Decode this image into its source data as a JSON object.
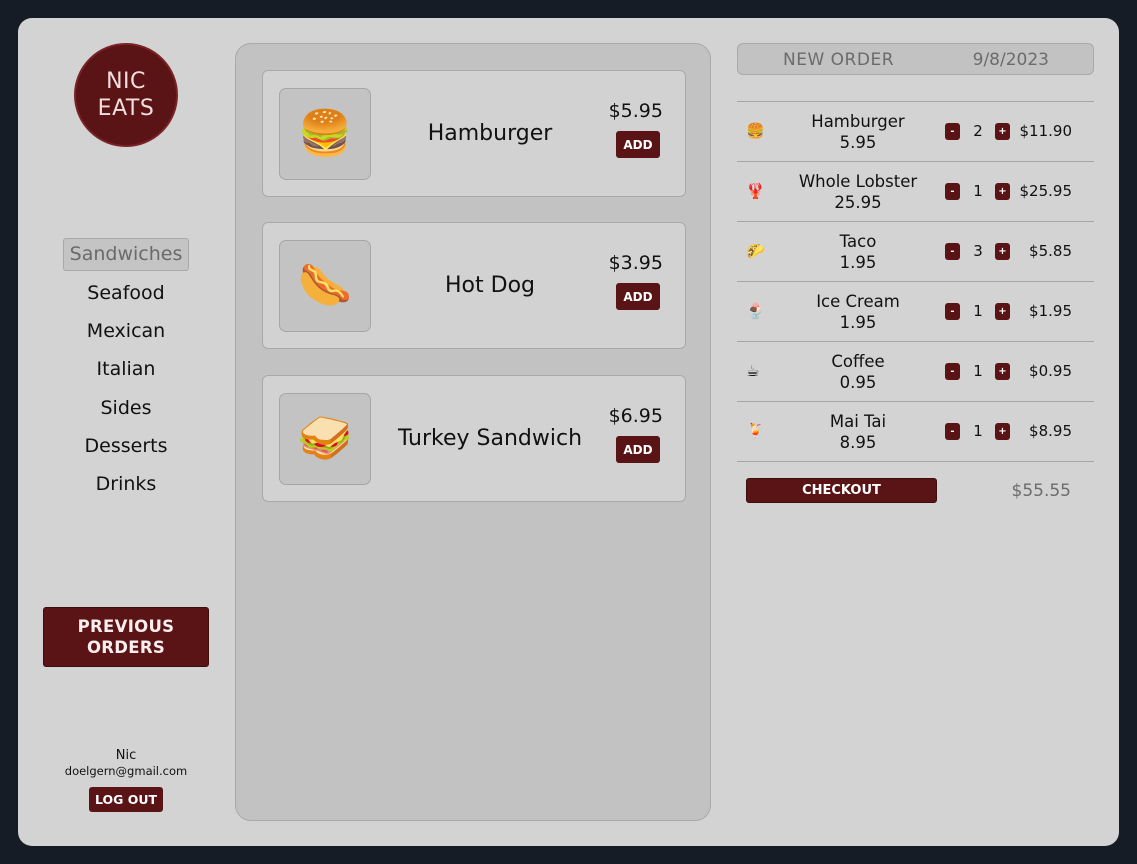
{
  "brand": {
    "line1": "NIC",
    "line2": "EATS"
  },
  "colors": {
    "accent": "#5a1416",
    "panel": "#d3d3d3",
    "background": "#161c26"
  },
  "categories": [
    {
      "label": "Sandwiches",
      "active": true
    },
    {
      "label": "Seafood"
    },
    {
      "label": "Mexican"
    },
    {
      "label": "Italian"
    },
    {
      "label": "Sides"
    },
    {
      "label": "Desserts"
    },
    {
      "label": "Drinks"
    }
  ],
  "previous_orders": {
    "line1": "PREVIOUS",
    "line2": "ORDERS"
  },
  "user": {
    "name": "Nic",
    "email": "doelgern@gmail.com",
    "logout": "LOG OUT"
  },
  "menu": {
    "items": [
      {
        "name": "Hamburger",
        "price": "$5.95",
        "emoji": "🍔",
        "icon": "hamburger-icon",
        "add": "ADD"
      },
      {
        "name": "Hot Dog",
        "price": "$3.95",
        "emoji": "🌭",
        "icon": "hot-dog-icon",
        "add": "ADD"
      },
      {
        "name": "Turkey Sandwich",
        "price": "$6.95",
        "emoji": "🥪",
        "icon": "sandwich-icon",
        "add": "ADD"
      }
    ]
  },
  "order": {
    "title": "NEW ORDER",
    "date": "9/8/2023",
    "items": [
      {
        "emoji": "🍔",
        "icon": "hamburger-icon",
        "name": "Hamburger",
        "price": "5.95",
        "qty": "2",
        "total": "$11.90"
      },
      {
        "emoji": "🦞",
        "icon": "lobster-icon",
        "name": "Whole Lobster",
        "price": "25.95",
        "qty": "1",
        "total": "$25.95"
      },
      {
        "emoji": "🌮",
        "icon": "taco-icon",
        "name": "Taco",
        "price": "1.95",
        "qty": "3",
        "total": "$5.85"
      },
      {
        "emoji": "🍨",
        "icon": "ice-cream-icon",
        "name": "Ice Cream",
        "price": "1.95",
        "qty": "1",
        "total": "$1.95"
      },
      {
        "emoji": "☕",
        "icon": "coffee-icon",
        "name": "Coffee",
        "price": "0.95",
        "qty": "1",
        "total": "$0.95"
      },
      {
        "emoji": "🍹",
        "icon": "cocktail-icon",
        "name": "Mai Tai",
        "price": "8.95",
        "qty": "1",
        "total": "$8.95"
      }
    ],
    "minus": "-",
    "plus": "+",
    "checkout": "CHECKOUT",
    "grand_total": "$55.55"
  }
}
